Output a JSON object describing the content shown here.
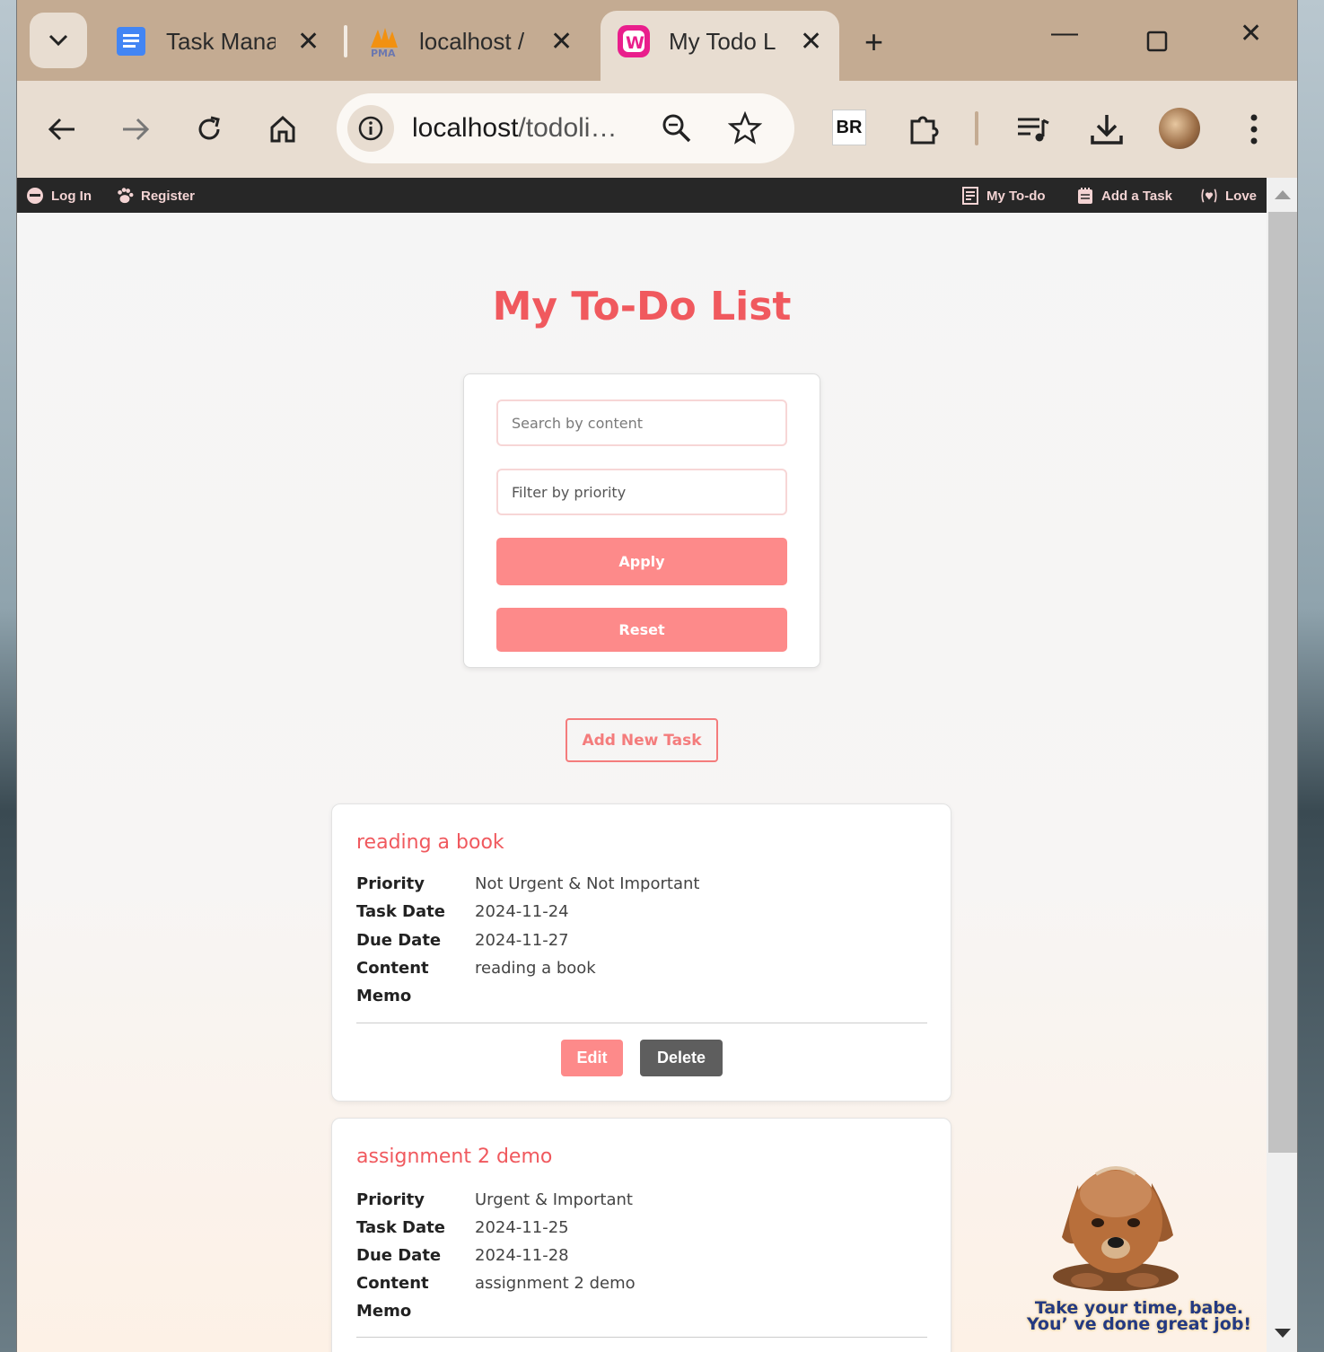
{
  "browser": {
    "tabs": [
      {
        "title": "Task Manag",
        "favicon": "google-docs-icon"
      },
      {
        "title": "localhost /",
        "favicon": "phpmyadmin-icon"
      },
      {
        "title": "My Todo L",
        "favicon": "wampserver-icon",
        "active": true
      }
    ],
    "url_host": "localhost",
    "url_path": "/todoli…",
    "extension_label": "BR"
  },
  "adminbar": {
    "login": "Log In",
    "register": "Register",
    "my_todo": "My To-do",
    "add_task": "Add a Task",
    "love": "Love"
  },
  "page": {
    "title": "My To-Do List",
    "search_placeholder": "Search by content",
    "priority_placeholder": "Filter by priority",
    "apply_label": "Apply",
    "reset_label": "Reset",
    "add_new_label": "Add New Task"
  },
  "labels": {
    "priority": "Priority",
    "task_date": "Task Date",
    "due_date": "Due Date",
    "content": "Content",
    "memo": "Memo",
    "edit": "Edit",
    "delete": "Delete"
  },
  "tasks": [
    {
      "title": "reading a book",
      "priority": "Not Urgent & Not Important",
      "task_date": "2024-11-24",
      "due_date": "2024-11-27",
      "content": "reading a book",
      "memo": ""
    },
    {
      "title": "assignment 2 demo",
      "priority": "Urgent & Important",
      "task_date": "2024-11-25",
      "due_date": "2024-11-28",
      "content": "assignment 2 demo",
      "memo": ""
    }
  ],
  "mascot": {
    "line1": "Take your time, babe.",
    "line2": "You’ ve done great job!"
  },
  "colors": {
    "accent": "#f0595e",
    "button": "#fd8a8a",
    "delete_button": "#5e5e5e",
    "adminbar": "#272727"
  }
}
